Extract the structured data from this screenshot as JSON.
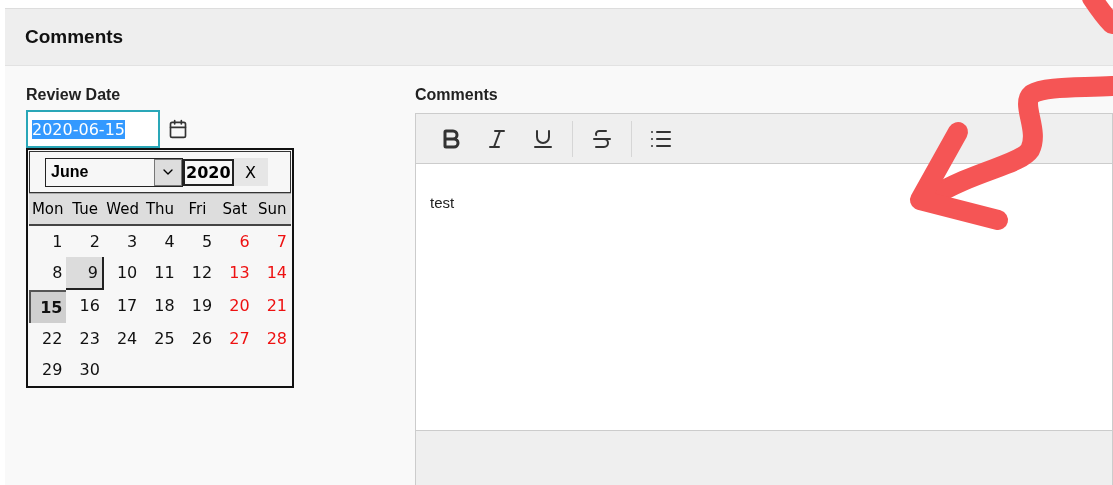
{
  "section": {
    "title": "Comments"
  },
  "review_date": {
    "label": "Review Date",
    "value": "2020-06-15",
    "calendar": {
      "month": "June",
      "year": "2020",
      "close": "X",
      "weekdays": [
        {
          "label": "Mon"
        },
        {
          "label": "Tue"
        },
        {
          "label": "Wed"
        },
        {
          "label": "Thu"
        },
        {
          "label": "Fri"
        },
        {
          "label": "Sat"
        },
        {
          "label": "Sun"
        }
      ],
      "weeks": [
        [
          {
            "day": "1",
            "weekend": false,
            "selected": false,
            "hovered": false
          },
          {
            "day": "2",
            "weekend": false,
            "selected": false,
            "hovered": false
          },
          {
            "day": "3",
            "weekend": false,
            "selected": false,
            "hovered": false
          },
          {
            "day": "4",
            "weekend": false,
            "selected": false,
            "hovered": false
          },
          {
            "day": "5",
            "weekend": false,
            "selected": false,
            "hovered": false
          },
          {
            "day": "6",
            "weekend": true,
            "selected": false,
            "hovered": false
          },
          {
            "day": "7",
            "weekend": true,
            "selected": false,
            "hovered": false
          }
        ],
        [
          {
            "day": "8",
            "weekend": false,
            "selected": false,
            "hovered": false
          },
          {
            "day": "9",
            "weekend": false,
            "selected": false,
            "hovered": true
          },
          {
            "day": "10",
            "weekend": false,
            "selected": false,
            "hovered": false
          },
          {
            "day": "11",
            "weekend": false,
            "selected": false,
            "hovered": false
          },
          {
            "day": "12",
            "weekend": false,
            "selected": false,
            "hovered": false
          },
          {
            "day": "13",
            "weekend": true,
            "selected": false,
            "hovered": false
          },
          {
            "day": "14",
            "weekend": true,
            "selected": false,
            "hovered": false
          }
        ],
        [
          {
            "day": "15",
            "weekend": false,
            "selected": true,
            "hovered": false
          },
          {
            "day": "16",
            "weekend": false,
            "selected": false,
            "hovered": false
          },
          {
            "day": "17",
            "weekend": false,
            "selected": false,
            "hovered": false
          },
          {
            "day": "18",
            "weekend": false,
            "selected": false,
            "hovered": false
          },
          {
            "day": "19",
            "weekend": false,
            "selected": false,
            "hovered": false
          },
          {
            "day": "20",
            "weekend": true,
            "selected": false,
            "hovered": false
          },
          {
            "day": "21",
            "weekend": true,
            "selected": false,
            "hovered": false
          }
        ],
        [
          {
            "day": "22",
            "weekend": false,
            "selected": false,
            "hovered": false
          },
          {
            "day": "23",
            "weekend": false,
            "selected": false,
            "hovered": false
          },
          {
            "day": "24",
            "weekend": false,
            "selected": false,
            "hovered": false
          },
          {
            "day": "25",
            "weekend": false,
            "selected": false,
            "hovered": false
          },
          {
            "day": "26",
            "weekend": false,
            "selected": false,
            "hovered": false
          },
          {
            "day": "27",
            "weekend": true,
            "selected": false,
            "hovered": false
          },
          {
            "day": "28",
            "weekend": true,
            "selected": false,
            "hovered": false
          }
        ],
        [
          {
            "day": "29",
            "weekend": false,
            "selected": false,
            "hovered": false
          },
          {
            "day": "30",
            "weekend": false,
            "selected": false,
            "hovered": false
          }
        ]
      ]
    }
  },
  "comments": {
    "label": "Comments",
    "toolbar": [
      [
        {
          "kind": "bold"
        },
        {
          "kind": "italic"
        },
        {
          "kind": "underline"
        }
      ],
      [
        {
          "kind": "strikethrough"
        }
      ],
      [
        {
          "kind": "bullet-list"
        }
      ]
    ],
    "text": "test"
  },
  "annotation": {
    "kind": "arrow"
  }
}
